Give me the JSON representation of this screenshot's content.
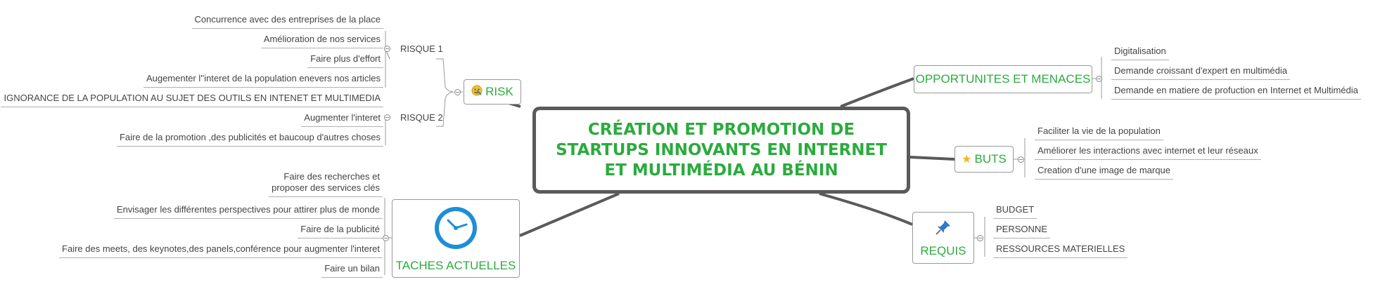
{
  "central": {
    "title": "CRÉATION ET PROMOTION DE STARTUPS INNOVANTS EN INTERNET ET MULTIMÉDIA AU BÉNIN"
  },
  "risk": {
    "label": "RISK",
    "icon": "smiley-icon",
    "groups": [
      {
        "label": "RISQUE 1",
        "items": [
          "Concurrence avec des entreprises de la place",
          "Amélioration de nos services",
          "Faire plus d'effort",
          "Augementer l''interet de la population enevers nos articles"
        ]
      },
      {
        "label": "RISQUE 2",
        "items": [
          "IGNORANCE DE LA POPULATION AU SUJET DES OUTILS EN INTENET ET MULTIMEDIA",
          "Augmenter l'interet",
          "Faire de la promotion ,des publicités et baucoup d'autres choses"
        ]
      }
    ]
  },
  "taches": {
    "label": "TACHES ACTUELLES",
    "icon": "clock-icon",
    "items": [
      "Faire des recherches et\nproposer des services clés",
      "Envisager les différentes perspectives pour attirer plus de monde",
      "Faire de la publicité",
      "Faire des meets, des keynotes,des panels,conférence pour augmenter l'interet",
      "Faire un bilan"
    ]
  },
  "opportunites": {
    "label": "OPPORTUNITES ET MENACES",
    "items": [
      "Digitalisation",
      "Demande croissant d'expert en multimédia",
      "Demande en matiere de profuction en Internet et Multimédia"
    ]
  },
  "buts": {
    "label": "BUTS",
    "icon": "star-icon",
    "items": [
      "Faciliter la vie de la population",
      "Améliorer les interactions avec internet et leur réseaux",
      "Creation d'une image de marque"
    ]
  },
  "requis": {
    "label": "REQUIS",
    "icon": "pushpin-icon",
    "items": [
      "BUDGET",
      "PERSONNE",
      "RESSOURCES MATERIELLES"
    ]
  },
  "colors": {
    "accent": "#2bab3e",
    "connector": "#5a5a5a",
    "line": "#b0b0b0"
  }
}
